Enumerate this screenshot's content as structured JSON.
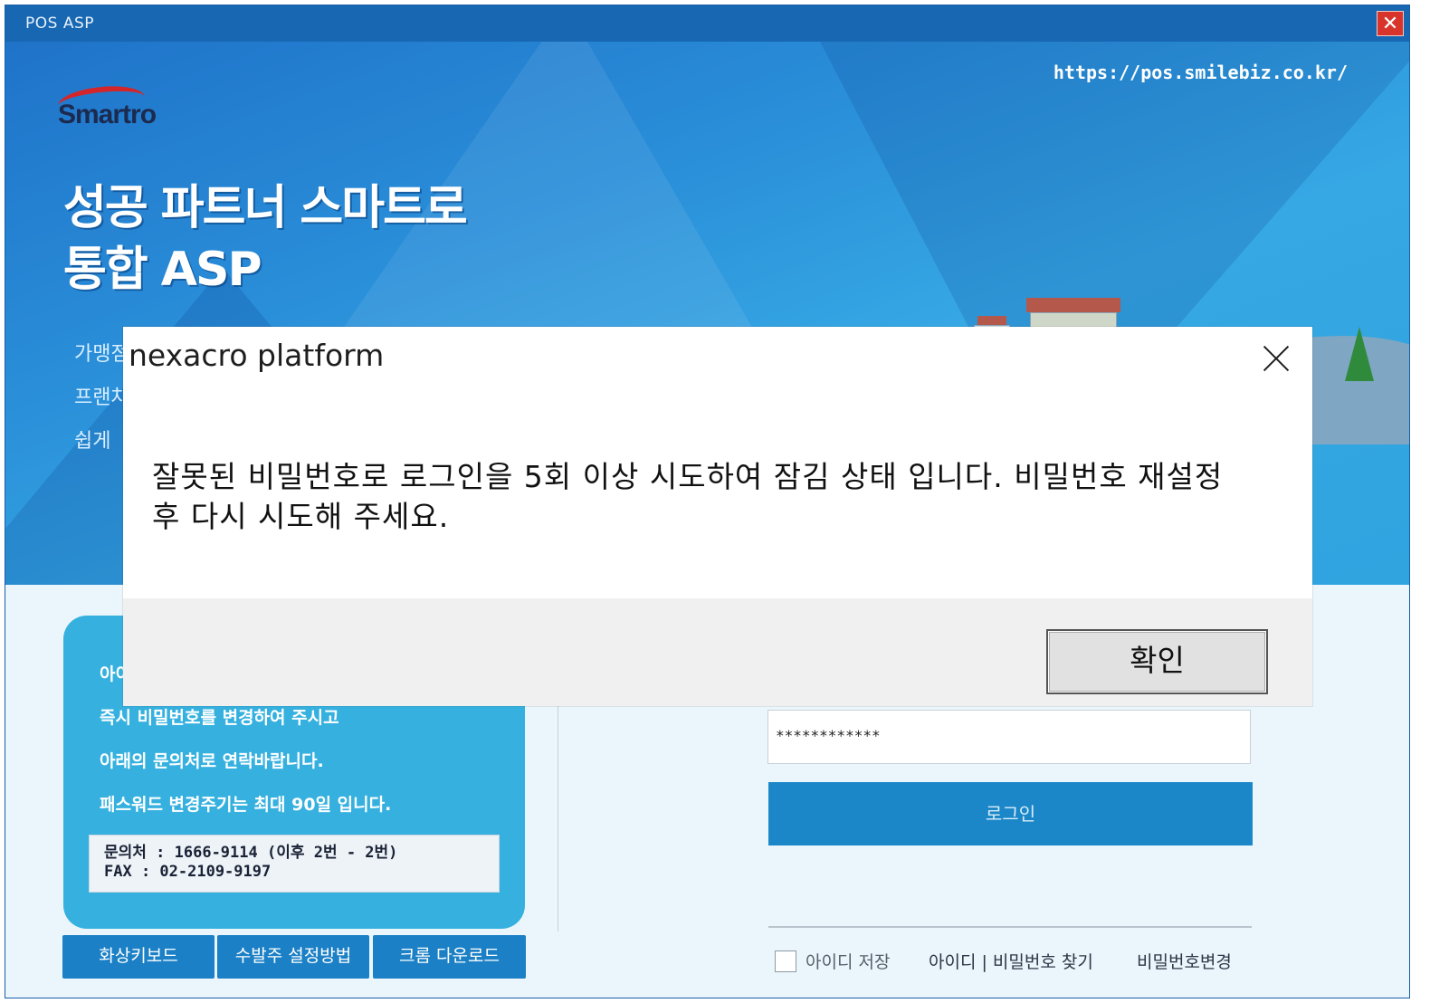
{
  "window": {
    "title": "POS ASP",
    "close_label": "✕"
  },
  "hero": {
    "url": "https://pos.smilebiz.co.kr/",
    "logo_text": "Smartro",
    "slogan_line1": "성공 파트너 스마트로",
    "slogan_line2": "통합 ASP",
    "desc_lines": [
      "가맹점",
      "프랜차",
      "쉽게 "
    ]
  },
  "notice": {
    "line1": "아이",
    "line2": "즉시 비밀번호를 변경하여 주시고",
    "line3": "아래의 문의처로 연락바랍니다.",
    "line4": "패스워드 변경주기는 최대 90일 입니다.",
    "contact_line1": "문의처 : 1666-9114 (이후 2번 - 2번)",
    "contact_line2": "FAX : 02-2109-9197"
  },
  "bottom_buttons": {
    "keyboard": "화상키보드",
    "order_setup": "수발주 설정방법",
    "chrome_download": "크롬 다운로드"
  },
  "login": {
    "password_value": "************",
    "login_button": "로그인",
    "save_id_label": "아이디 저장",
    "find_link": "아이디 | 비밀번호 찾기",
    "change_pw_link": "비밀번호변경"
  },
  "dialog": {
    "title": "nexacro platform",
    "message": "잘못된 비밀번호로 로그인을 5회 이상 시도하여 잠김 상태 입니다. 비밀번호 재설정 후 다시 시도해 주세요.",
    "ok_label": "확인"
  },
  "colors": {
    "titlebar": "#1767b3",
    "accent": "#1b87c8",
    "notice_bg": "#36b1df",
    "close_red": "#d9342b"
  }
}
